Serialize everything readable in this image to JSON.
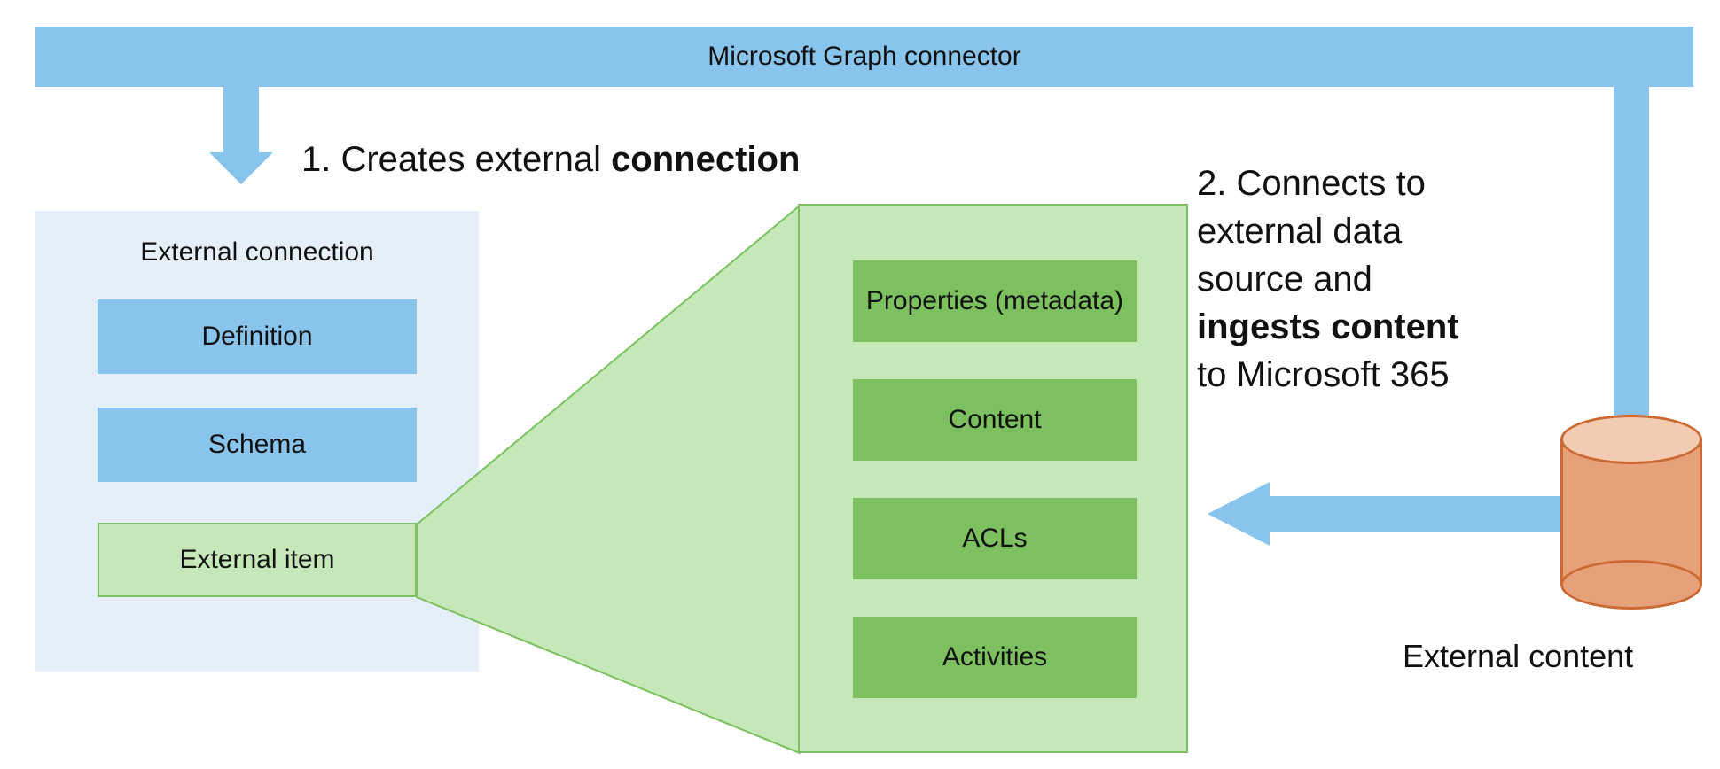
{
  "top_bar": {
    "label": "Microsoft Graph connector"
  },
  "step1": {
    "prefix": "1. Creates external ",
    "bold": "connection"
  },
  "step2": {
    "line1": "2. Connects to",
    "line2": "external data",
    "line3": "source and",
    "bold": "ingests content",
    "line5": "to Microsoft 365"
  },
  "connection_panel": {
    "title": "External connection",
    "definition": "Definition",
    "schema": "Schema",
    "external_item": "External item"
  },
  "details_panel": {
    "properties": "Properties (metadata)",
    "content": "Content",
    "acls": "ACLs",
    "activities": "Activities"
  },
  "external_content_label": "External content",
  "colors": {
    "blue": "#88c4eb",
    "blue_pale": "#e4effa",
    "green": "#7cc060",
    "green_pale": "#c6e8b8",
    "orange": "#e6a07a",
    "orange_light": "#f2cbb3",
    "orange_border": "#cc6a33"
  }
}
